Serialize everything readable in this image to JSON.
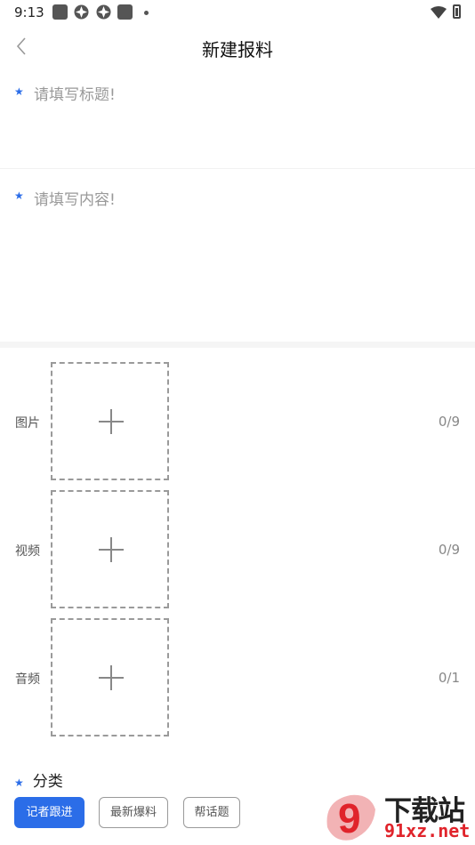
{
  "status_bar": {
    "time": "9:13"
  },
  "nav": {
    "title": "新建报料"
  },
  "form": {
    "title_placeholder": "请填写标题!",
    "content_placeholder": "请填写内容!"
  },
  "media": [
    {
      "label": "图片",
      "count": "0/9"
    },
    {
      "label": "视频",
      "count": "0/9"
    },
    {
      "label": "音频",
      "count": "0/1"
    }
  ],
  "category": {
    "title": "分类",
    "options": [
      "记者跟进",
      "最新爆料",
      "帮话题"
    ],
    "selected": "记者跟进"
  },
  "colors": {
    "accent": "#2b6de8",
    "placeholder": "#999999"
  },
  "watermark": {
    "text": "下载站",
    "domain": "91xz.net",
    "logo_glyph": "9"
  }
}
